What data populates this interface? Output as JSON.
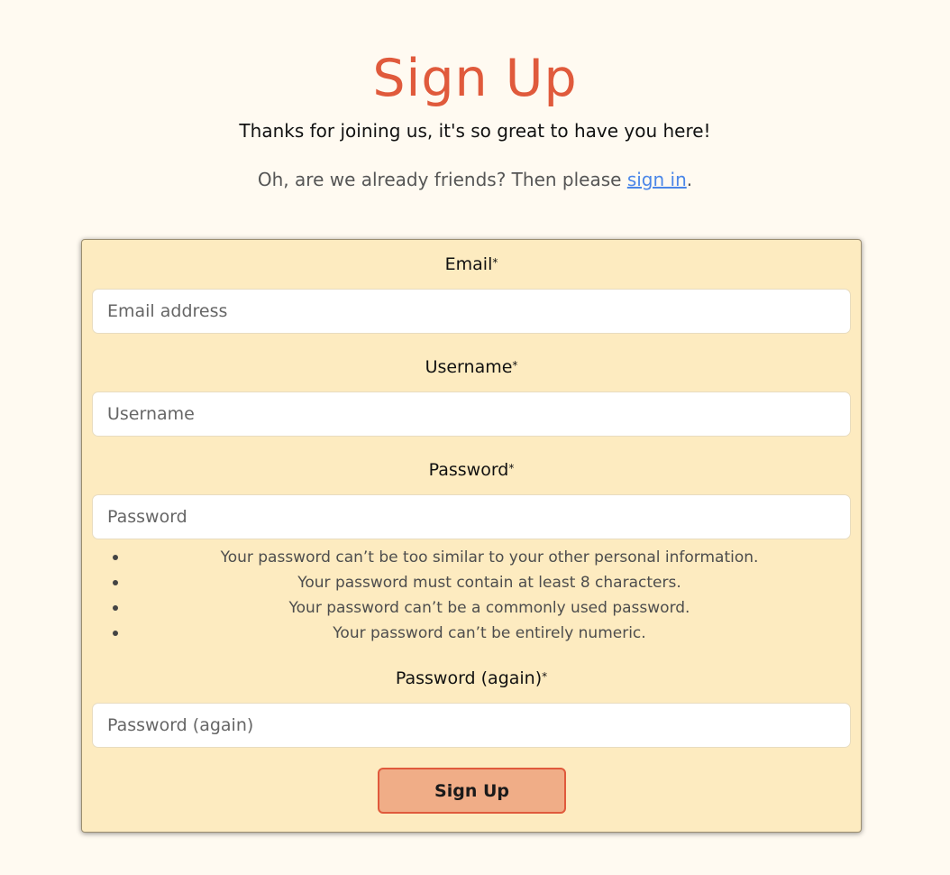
{
  "page": {
    "title": "Sign Up",
    "welcome": "Thanks for joining us, it's so great to have you here!",
    "signin_prefix": "Oh, are we already friends? Then please ",
    "signin_link": "sign in",
    "signin_suffix": "."
  },
  "form": {
    "email": {
      "label": "Email",
      "required_mark": "*",
      "placeholder": "Email address",
      "value": ""
    },
    "username": {
      "label": "Username",
      "required_mark": "*",
      "placeholder": "Username",
      "value": ""
    },
    "password": {
      "label": "Password",
      "required_mark": "*",
      "placeholder": "Password",
      "value": ""
    },
    "password_help": [
      "Your password can’t be too similar to your other personal information.",
      "Your password must contain at least 8 characters.",
      "Your password can’t be a commonly used password.",
      "Your password can’t be entirely numeric."
    ],
    "password2": {
      "label": "Password (again)",
      "required_mark": "*",
      "placeholder": "Password (again)",
      "value": ""
    },
    "submit_label": "Sign Up"
  },
  "colors": {
    "background": "#fffaf1",
    "card": "#fdebc0",
    "accent": "#e05a3c",
    "button_fill": "#f0ad87",
    "link": "#4a86e8"
  }
}
